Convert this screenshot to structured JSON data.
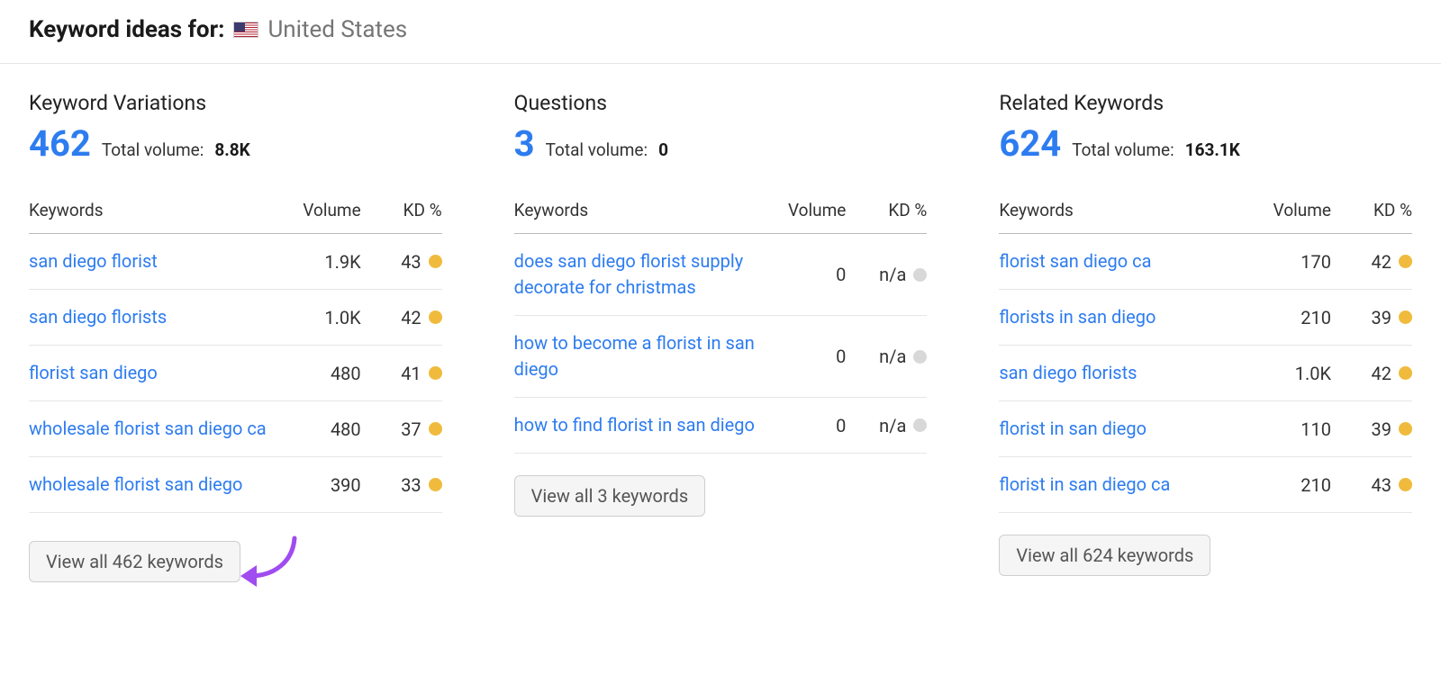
{
  "header": {
    "title_prefix": "Keyword ideas for:",
    "country": "United States"
  },
  "columns": {
    "keywords": "Keywords",
    "volume": "Volume",
    "kd": "KD %"
  },
  "labels": {
    "total_volume": "Total volume:"
  },
  "panels": [
    {
      "id": "variations",
      "title": "Keyword Variations",
      "count": "462",
      "total_volume": "8.8K",
      "view_all": "View all 462 keywords",
      "show_arrow": true,
      "rows": [
        {
          "keyword": "san diego florist",
          "volume": "1.9K",
          "kd": "43",
          "dot": "yellow"
        },
        {
          "keyword": "san diego florists",
          "volume": "1.0K",
          "kd": "42",
          "dot": "yellow"
        },
        {
          "keyword": "florist san diego",
          "volume": "480",
          "kd": "41",
          "dot": "yellow"
        },
        {
          "keyword": "wholesale florist san diego ca",
          "volume": "480",
          "kd": "37",
          "dot": "yellow"
        },
        {
          "keyword": "wholesale florist san diego",
          "volume": "390",
          "kd": "33",
          "dot": "yellow"
        }
      ]
    },
    {
      "id": "questions",
      "title": "Questions",
      "count": "3",
      "total_volume": "0",
      "view_all": "View all 3 keywords",
      "show_arrow": false,
      "rows": [
        {
          "keyword": "does san diego florist supply decorate for christmas",
          "volume": "0",
          "kd": "n/a",
          "dot": "gray"
        },
        {
          "keyword": "how to become a florist in san diego",
          "volume": "0",
          "kd": "n/a",
          "dot": "gray"
        },
        {
          "keyword": "how to find florist in san diego",
          "volume": "0",
          "kd": "n/a",
          "dot": "gray"
        }
      ]
    },
    {
      "id": "related",
      "title": "Related Keywords",
      "count": "624",
      "total_volume": "163.1K",
      "view_all": "View all 624 keywords",
      "show_arrow": false,
      "rows": [
        {
          "keyword": "florist san diego ca",
          "volume": "170",
          "kd": "42",
          "dot": "yellow"
        },
        {
          "keyword": "florists in san diego",
          "volume": "210",
          "kd": "39",
          "dot": "yellow"
        },
        {
          "keyword": "san diego florists",
          "volume": "1.0K",
          "kd": "42",
          "dot": "yellow"
        },
        {
          "keyword": "florist in san diego",
          "volume": "110",
          "kd": "39",
          "dot": "yellow"
        },
        {
          "keyword": "florist in san diego ca",
          "volume": "210",
          "kd": "43",
          "dot": "yellow"
        }
      ]
    }
  ]
}
